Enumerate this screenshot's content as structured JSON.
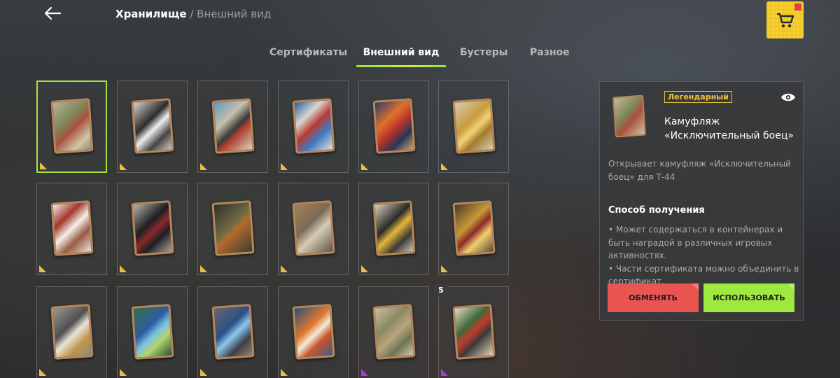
{
  "header": {
    "breadcrumb_current": "Хранилище",
    "breadcrumb_sep": " / ",
    "breadcrumb_sub": "Внешний вид"
  },
  "icons": {
    "back": "arrow-left-icon",
    "shop": "cart-icon",
    "preview": "eye-icon"
  },
  "tabs": [
    {
      "label": "Сертификаты",
      "active": false
    },
    {
      "label": "Внешний вид",
      "active": true
    },
    {
      "label": "Бустеры",
      "active": false
    },
    {
      "label": "Разное",
      "active": false
    }
  ],
  "colors": {
    "accent_green": "#a5e33a",
    "legendary_gold": "#e9c13a",
    "epic_purple": "#a43cd8",
    "exchange_red": "#ea5552",
    "shop_yellow": "#f2c924"
  },
  "items": [
    {
      "rarity": "gold",
      "selected": true,
      "theme": "camo-green"
    },
    {
      "rarity": "gold",
      "selected": false,
      "theme": "dark-rhino"
    },
    {
      "rarity": "gold",
      "selected": false,
      "theme": "blue-geometry"
    },
    {
      "rarity": "gold",
      "selected": false,
      "theme": "blue-red-stripes"
    },
    {
      "rarity": "gold",
      "selected": false,
      "theme": "orange-ornament"
    },
    {
      "rarity": "gold",
      "selected": false,
      "theme": "gold-lion"
    },
    {
      "rarity": "gold",
      "selected": false,
      "theme": "white-claws"
    },
    {
      "rarity": "gold",
      "selected": false,
      "theme": "black-demon"
    },
    {
      "rarity": "gold",
      "selected": false,
      "theme": "olive-split"
    },
    {
      "rarity": "gold",
      "selected": false,
      "theme": "brown-scales"
    },
    {
      "rarity": "gold",
      "selected": false,
      "theme": "panther"
    },
    {
      "rarity": "gold",
      "selected": false,
      "theme": "gold-dragon"
    },
    {
      "rarity": "gold",
      "selected": false,
      "theme": "eagle-chevron"
    },
    {
      "rarity": "gold",
      "selected": false,
      "theme": "map-blue"
    },
    {
      "rarity": "gold",
      "selected": false,
      "theme": "blue-crystal"
    },
    {
      "rarity": "gold",
      "selected": false,
      "theme": "koi-fish"
    },
    {
      "rarity": "purple",
      "selected": false,
      "theme": "pixel-camo"
    },
    {
      "rarity": "purple",
      "selected": false,
      "theme": "t44-art",
      "count": "5"
    }
  ],
  "details": {
    "rarity_label": "Легендарный",
    "name_line1": "Камуфляж",
    "name_line2": "«Исключительный боец»",
    "description": "Открывает камуфляж «Исключительный боец» для Т-44",
    "how_title": "Способ получения",
    "how_items": [
      "• Может содержаться в контейнерах и быть наградой в различных игровых активностях.",
      "• Части сертификата можно объединить в сертификат."
    ],
    "exchange_label": "ОБМЕНЯТЬ",
    "use_label": "ИСПОЛЬЗОВАТЬ"
  }
}
